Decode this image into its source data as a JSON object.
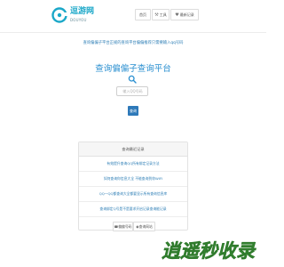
{
  "brand": {
    "name": "逗游网",
    "tagline": "DOUYOU",
    "colors": {
      "primary": "#1aa7c8",
      "accent": "#2a8fd0",
      "button": "#2e79b9"
    }
  },
  "nav": {
    "home": {
      "label": "首页"
    },
    "tools": {
      "label": "工具",
      "icon": "wrench-icon"
    },
    "recent": {
      "label": "最新记录",
      "icon": "heart-icon"
    }
  },
  "notice": "查询偏偏子平台正规的查询平台偏偏推荐只需要输入qq号码",
  "main": {
    "title": "查询偏偏子查询平台",
    "search_icon": "search-icon",
    "search_placeholder": "输入QQ号码",
    "search_value": "",
    "query_button": "查询"
  },
  "panel": {
    "header": "查询最近记录",
    "rows": [
      "有效提升查询QQ所有绑定记录方法",
      "如何查询你信息大全 不能查询到你WIFI",
      "QQ一QQ都查询大全都要显示所有查询信息库",
      "查询绑定Q号是不是要求开启记录查询能记录"
    ]
  },
  "tags": {
    "left": {
      "label": "偏偏号码",
      "icon": "phone-icon"
    },
    "right": {
      "label": "查询网站",
      "icon": "globe-icon"
    }
  },
  "watermark": {
    "text": "逍遥秒收录",
    "color": "#3e9a3a"
  }
}
